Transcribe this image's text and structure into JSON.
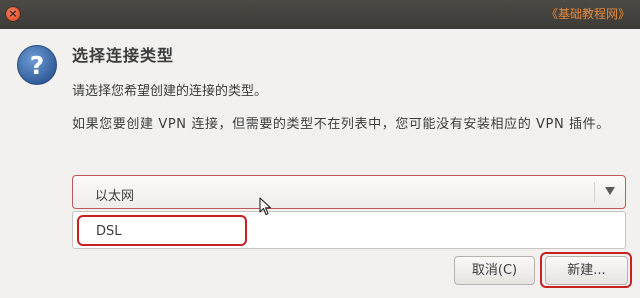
{
  "titlebar": {
    "close_symbol": "×",
    "watermark": "《基础教程网》"
  },
  "dialog": {
    "icon": "question-icon",
    "heading": "选择连接类型",
    "subtext": "请选择您希望创建的连接的类型。",
    "paragraph": "如果您要创建 VPN 连接，但需要的类型不在列表中，您可能没有安装相应的 VPN 插件。"
  },
  "connection_type": {
    "selected": "以太网",
    "options_visible": [
      "DSL"
    ]
  },
  "buttons": {
    "cancel_label": "取消(C)",
    "new_label": "新建..."
  },
  "colors": {
    "highlight_outline": "#c62222",
    "titlebar": "#3c3b37",
    "watermark": "#e58a3c",
    "icon_blue": "#3f6fb0"
  }
}
